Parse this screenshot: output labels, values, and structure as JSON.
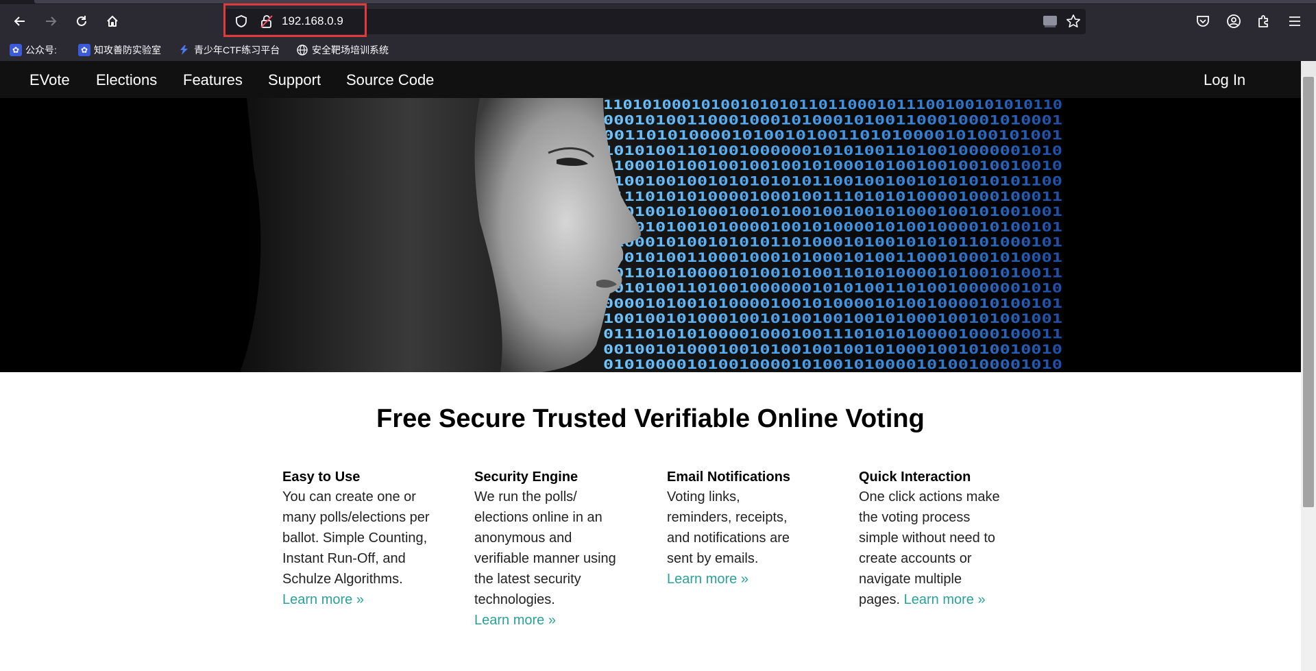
{
  "browser": {
    "url": "192.168.0.9",
    "bookmarks": [
      {
        "label": "公众号:",
        "icon": "paw-icon"
      },
      {
        "label": "知攻善防实验室",
        "icon": "paw-icon"
      },
      {
        "label": "青少年CTF练习平台",
        "icon": "ctf-logo-icon"
      },
      {
        "label": "安全靶场培训系统",
        "icon": "globe-icon"
      }
    ]
  },
  "site": {
    "brand": "EVote",
    "nav": [
      "Elections",
      "Features",
      "Support",
      "Source Code"
    ],
    "login": "Log In"
  },
  "hero": {
    "binary_rows": [
      "11010100010100101010110110001011100100101010110",
      "00010100110001000101000101001100010001010001",
      "0011010100001010010100110101000010100101001",
      "10101001101001000000101010011010010000001010",
      "01000101001001001001010001010010010010010010",
      "11001001001010101010110010010010101010101100",
      "01110101010000100010011101010100001000100011",
      "10010010100010010100100100101000100101001001",
      "00001010010100001001010000101001000010100101",
      "01000101001010101101000101001010101101000101",
      "10010100110001000101000101001100010001010001",
      "00110101000010100101001101010000101001010011",
      "10101001101001000000101010011010010000001010",
      "00001010010100001001010000101001000010100101",
      "10010010100010010100100100101000100101001001",
      "01110101010000100010011101010100001000100011",
      "00100101000100101001001001010001001010010010",
      "01010000101001000010100101000010100100001010"
    ]
  },
  "main": {
    "headline": "Free Secure Trusted Verifiable Online Voting",
    "features": [
      {
        "title": "Easy to Use",
        "text": "You can create one or many polls/elections per ballot. Simple Counting, Instant Run-Off, and Schulze Algorithms.",
        "link": "Learn more »"
      },
      {
        "title": "Security Engine",
        "text": "We run the polls/ elections online in an anonymous and verifiable manner using the latest security technologies.",
        "link": "Learn more »"
      },
      {
        "title": "Email Notifications",
        "text": "Voting links, reminders, receipts, and notifications are sent by emails.",
        "link": "Learn more »"
      },
      {
        "title": "Quick Interaction",
        "text": "One click actions make the voting process simple without need to create accounts or navigate multiple pages.",
        "link": "Learn more »"
      }
    ]
  }
}
